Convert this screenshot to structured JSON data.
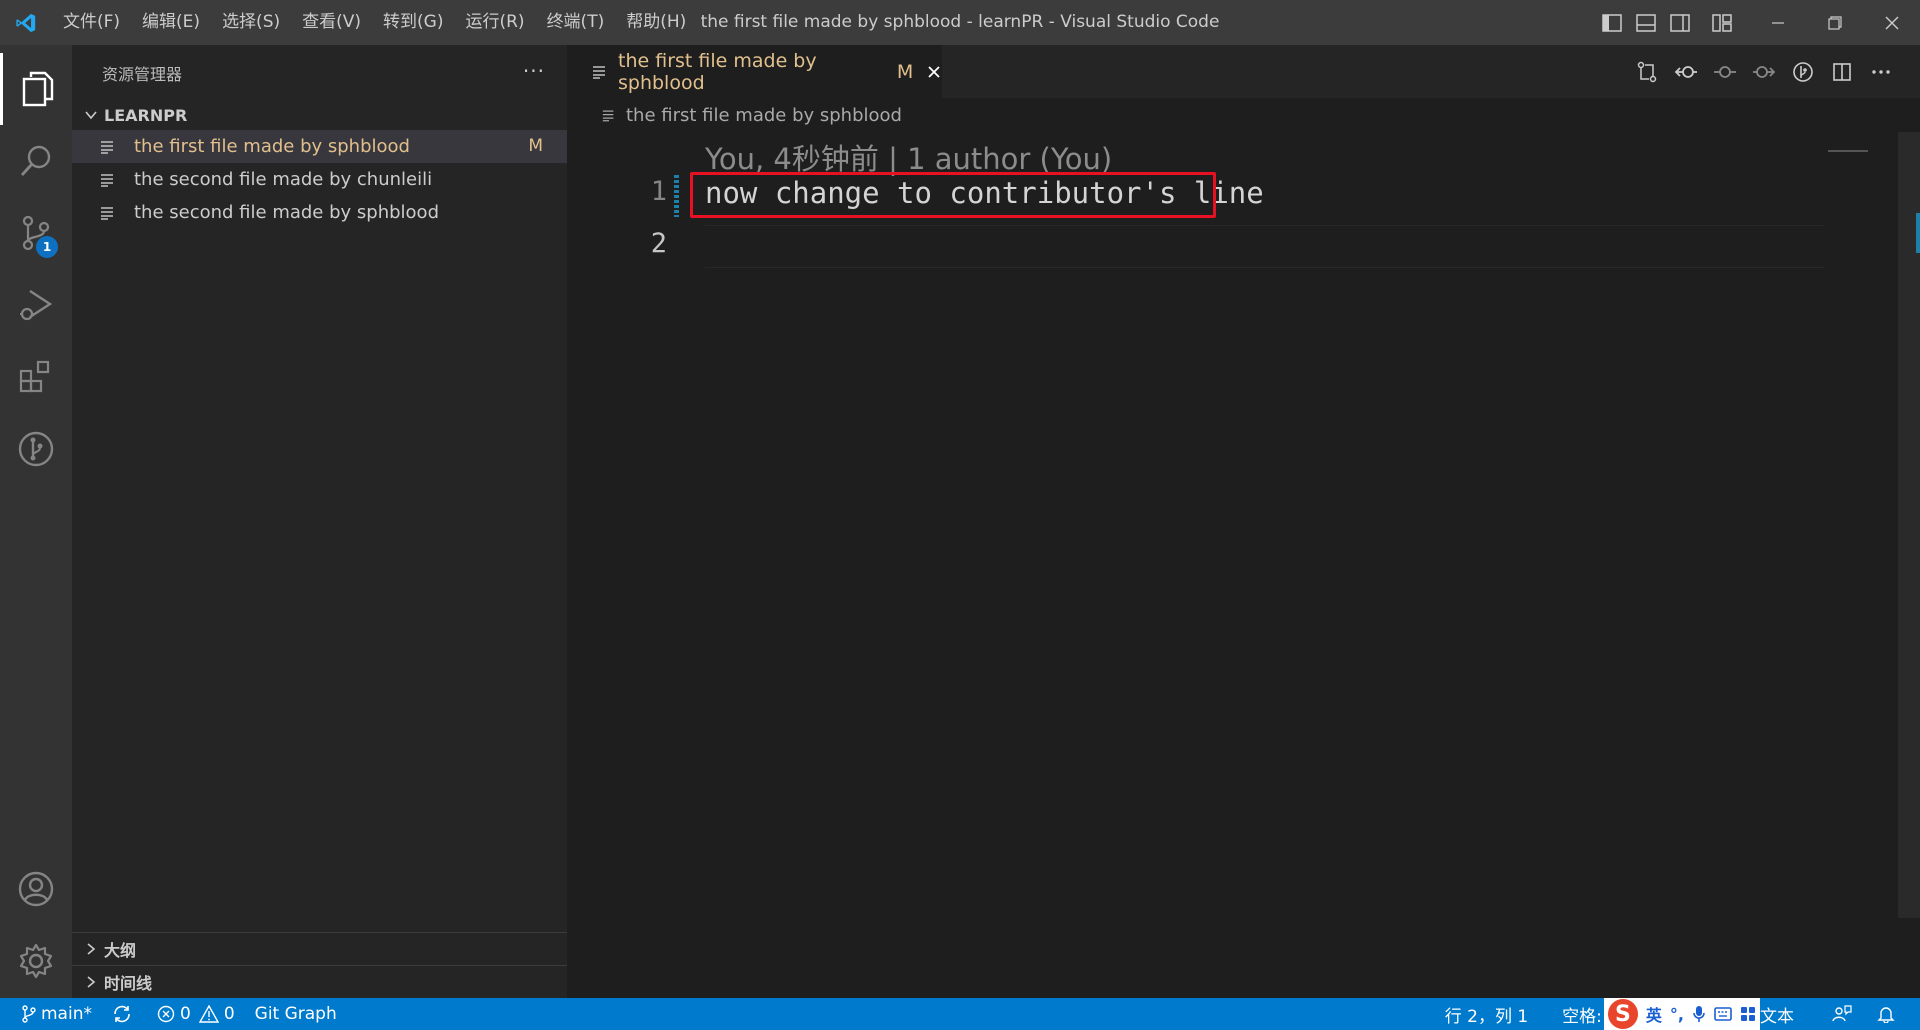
{
  "window": {
    "title": "the first file made by sphblood - learnPR - Visual Studio Code",
    "logo_icon": "vscode-logo"
  },
  "menu": [
    "文件(F)",
    "编辑(E)",
    "选择(S)",
    "查看(V)",
    "转到(G)",
    "运行(R)",
    "终端(T)",
    "帮助(H)"
  ],
  "activity_bar": {
    "items": [
      "explorer-icon",
      "search-icon",
      "source-control-icon",
      "run-debug-icon",
      "extensions-icon",
      "git-graph-icon"
    ],
    "source_control_badge": "1",
    "bottom": [
      "account-icon",
      "settings-gear-icon"
    ]
  },
  "sidebar": {
    "title": "资源管理器",
    "more": "···",
    "folder": "LEARNPR",
    "files": [
      {
        "name": "the first file made by sphblood",
        "badge": "M"
      },
      {
        "name": "the second file made by chunleili",
        "badge": ""
      },
      {
        "name": "the second file made by sphblood",
        "badge": ""
      }
    ],
    "outline": "大纲",
    "timeline": "时间线"
  },
  "editor": {
    "tab": {
      "label": "the first file made by sphblood",
      "modified": "M"
    },
    "breadcrumb": "the first file made by sphblood",
    "codelens": "You, 4秒钟前 | 1 author (You)",
    "lines": [
      {
        "number": "1",
        "text": "now change to contributor's line"
      },
      {
        "number": "2",
        "text": ""
      }
    ]
  },
  "statusbar": {
    "branch": "main*",
    "errors": "0",
    "warnings": "0",
    "git_graph": "Git Graph",
    "position": "行 2，列 1",
    "spaces": "空格:",
    "ime_lang": "英",
    "ime_punct": "°,",
    "language": "文本"
  },
  "colors": {
    "accent": "#007acc",
    "modified": "#e2c08d",
    "highlight_box": "#e81123"
  }
}
